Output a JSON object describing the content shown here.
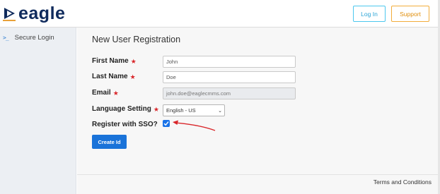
{
  "header": {
    "logo_text": "eagle",
    "login_label": "Log In",
    "support_label": "Support"
  },
  "sidebar": {
    "items": [
      {
        "label": "Secure Login",
        "icon": "terminal-icon"
      }
    ]
  },
  "main": {
    "title": "New User Registration",
    "fields": {
      "first_name": {
        "label": "First Name",
        "value": "John"
      },
      "last_name": {
        "label": "Last Name",
        "value": "Doe"
      },
      "email": {
        "label": "Email",
        "value": "john.doe@eaglecmms.com"
      },
      "language": {
        "label": "Language Setting",
        "value": "English - US"
      },
      "sso": {
        "label": "Register with SSO?",
        "checked": true
      }
    },
    "create_label": "Create Id"
  },
  "footer": {
    "terms_label": "Terms and Conditions"
  },
  "colors": {
    "brand": "#0f2a5c",
    "login_border": "#4cc7ee",
    "support_border": "#f2ad3b",
    "primary_button": "#1a73d9",
    "required_star": "#d9262a",
    "annotation_arrow": "#d9262a"
  }
}
